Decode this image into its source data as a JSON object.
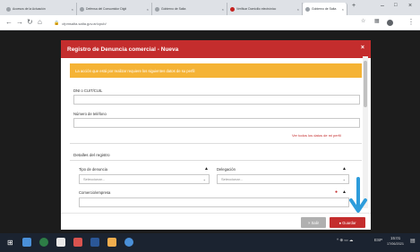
{
  "browser": {
    "tabs": [
      {
        "label": "Accesos de la Actuación"
      },
      {
        "label": "Defensa del Consumidor Digit"
      },
      {
        "label": "Gobierno de Salta"
      },
      {
        "label": "Verificar Domicilio electrónico"
      },
      {
        "label": "Gobierno de Salta"
      }
    ],
    "new_tab": "+",
    "url": "cfpmsalta.salta.gov.ar/cpub/"
  },
  "modal": {
    "title": "Registro de Denuncia comercial - Nueva",
    "close": "×",
    "alert": "La acción que está por realizar requiere los siguientes datos de su perfil",
    "dni_label": "DNI o CUIT/CUIL",
    "phone_label": "Número de teléfono",
    "profile_link": "Ver todos los datos de mi perfil",
    "section_title": "Detalles del registro",
    "tipo_label": "Tipo de denuncia",
    "tipo_value": "Seleccionar...",
    "delegacion_label": "Delegación",
    "delegacion_value": "Seleccionar...",
    "comercio_label": "Comercio/empresa",
    "cancel_label": "× Salir",
    "save_label": "● Guardar"
  },
  "taskbar": {
    "tray": "ESP",
    "time": "15:01",
    "date": "17/06/2021"
  }
}
